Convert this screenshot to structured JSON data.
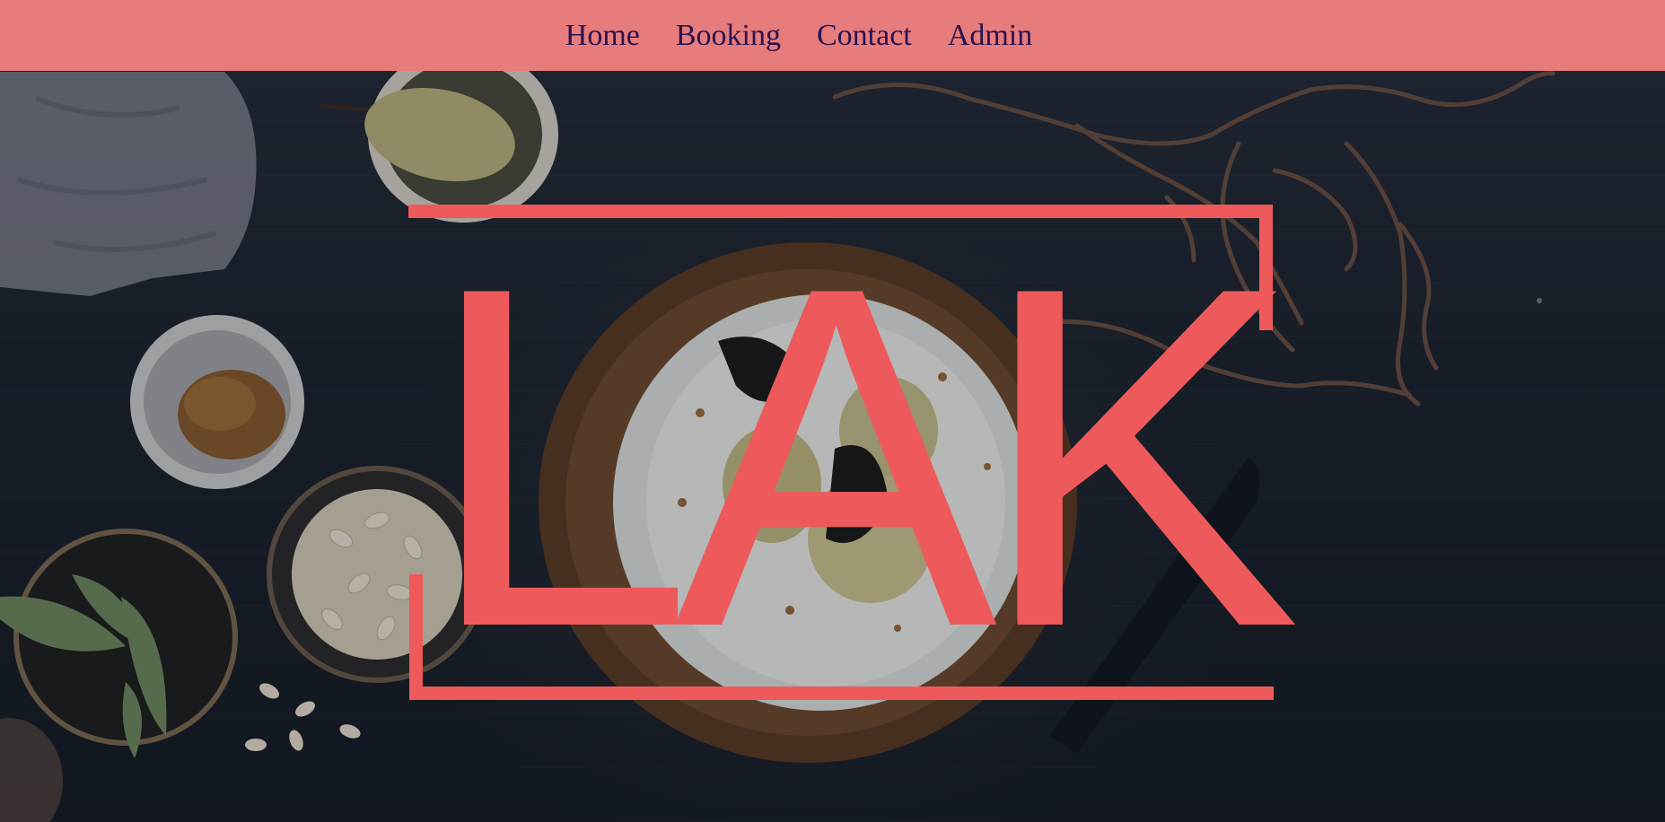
{
  "nav": {
    "items": [
      {
        "label": "Home"
      },
      {
        "label": "Booking"
      },
      {
        "label": "Contact"
      },
      {
        "label": "Admin"
      }
    ]
  },
  "hero": {
    "logo_text": "LAK"
  },
  "colors": {
    "nav_bg": "#e77c7c",
    "nav_text": "#2a1250",
    "logo": "#ee5a5c",
    "hero_bg": "#1b222c"
  }
}
